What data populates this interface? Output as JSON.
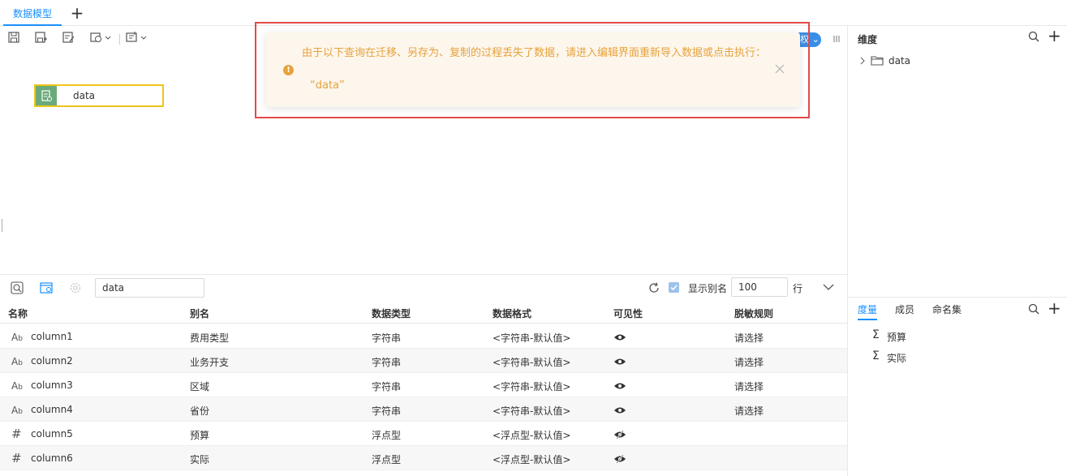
{
  "tabs": {
    "active_label": "数据模型",
    "add_label": "+"
  },
  "toolbar": {
    "right_button_label": "权"
  },
  "canvas": {
    "node_label": "data"
  },
  "toast": {
    "message": "由于以下查询在迁移、另存为、复制的过程丢失了数据，请进入编辑界面重新导入数据或点击执行：",
    "query": "“data”",
    "icon": "!"
  },
  "dimensions": {
    "title": "维度",
    "add_label": "+",
    "tree": [
      {
        "label": "data"
      }
    ]
  },
  "measures_panel": {
    "tabs": [
      "度量",
      "成员",
      "命名集"
    ],
    "add_label": "+",
    "items": [
      {
        "label": "预算"
      },
      {
        "label": "实际"
      }
    ]
  },
  "bottom": {
    "name_input_value": "data",
    "show_alias_label": "显示别名",
    "rows_value": "100",
    "rows_unit": "行",
    "headers": [
      "名称",
      "别名",
      "数据类型",
      "数据格式",
      "可见性",
      "脱敏规则"
    ],
    "rows": [
      {
        "type_icon": "text",
        "name": "column1",
        "alias": "费用类型",
        "dtype": "字符串",
        "format": "<字符串-默认值>",
        "visible": "visible",
        "mask": "请选择"
      },
      {
        "type_icon": "text",
        "name": "column2",
        "alias": "业务开支",
        "dtype": "字符串",
        "format": "<字符串-默认值>",
        "visible": "visible",
        "mask": "请选择"
      },
      {
        "type_icon": "text",
        "name": "column3",
        "alias": "区域",
        "dtype": "字符串",
        "format": "<字符串-默认值>",
        "visible": "visible",
        "mask": "请选择"
      },
      {
        "type_icon": "text",
        "name": "column4",
        "alias": "省份",
        "dtype": "字符串",
        "format": "<字符串-默认值>",
        "visible": "visible",
        "mask": "请选择"
      },
      {
        "type_icon": "number",
        "name": "column5",
        "alias": "预算",
        "dtype": "浮点型",
        "format": "<浮点型-默认值>",
        "visible": "hidden",
        "mask": ""
      },
      {
        "type_icon": "number",
        "name": "column6",
        "alias": "实际",
        "dtype": "浮点型",
        "format": "<浮点型-默认值>",
        "visible": "hidden",
        "mask": ""
      }
    ]
  },
  "colors": {
    "accent": "#1890ff",
    "warning": "#e6a23c",
    "toast_bg": "#fdf6ec",
    "highlight": "#e24a4a",
    "node_border": "#f0c419"
  }
}
